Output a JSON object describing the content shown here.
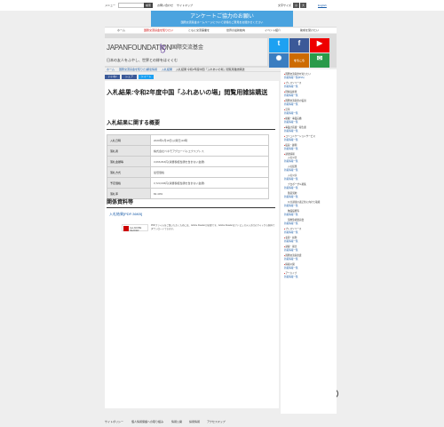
{
  "utility": {
    "menu": "メニュー",
    "search_btn": "検索",
    "link1": "お問い合わせ",
    "link2": "サイトマップ",
    "font_size": "文字サイズ",
    "fs_small": "小",
    "fs_large": "大",
    "lang": "English"
  },
  "banner": {
    "line1": "アンケートご協力のお願い",
    "line2": "国際交流基金ホームページについて皆様のご意見をお聞かせください"
  },
  "nav": [
    "ホーム",
    "国際交流基金を知りたい",
    "ともに交流事業を",
    "世界の最新動向",
    "イベント紹介",
    "助成を受けたい"
  ],
  "header": {
    "logo_en": "JAPANFOUNDATION",
    "logo_mark": "ɮ",
    "logo_jp": "国際交流基金",
    "tagline": "日本の友人をふやし、世界との絆をはぐくむ",
    "footer_text": "人物検索でPR"
  },
  "sns": [
    {
      "icon": "twitter-icon",
      "glyph": "t",
      "color": "#1da1f2"
    },
    {
      "icon": "facebook-icon",
      "glyph": "f",
      "color": "#3b5998"
    },
    {
      "icon": "youtube-icon",
      "glyph": "▶",
      "color": "#e00"
    },
    {
      "icon": "globe-icon",
      "glyph": "✺",
      "color": "#3b7dc0"
    },
    {
      "icon": "magazine-icon",
      "glyph": "をちこち",
      "color": "#cc6a00"
    },
    {
      "icon": "mail-icon",
      "glyph": "✉",
      "color": "#2a9a4a"
    }
  ],
  "breadcrumb": [
    "ホーム",
    "国際交流基金を知りたい",
    "調達情報",
    "入札結果",
    "入札結果:令和2年度中国「ふれあいの場」閲覧用雑誌購送"
  ],
  "share": [
    "いいね!",
    "シェア",
    "ツイート"
  ],
  "page": {
    "title": "入札結果:令和2年度中国「ふれあいの場」閲覧用雑誌購送",
    "section1": "入札結果に関する概要",
    "section2": "関係資料等",
    "download": "入札結果[PDF:36KB]",
    "acrobat": "Get ADOBE READER",
    "adobe_note": "PDFファイルをご覧いただくためには、Adobe Readerが必要です。Adobe Readerはアドビシステムズ社のサイトから無料でダウンロードできます。"
  },
  "info_table": [
    {
      "k": "入札日時",
      "v": "2020年2月18日(火曜日)10時"
    },
    {
      "k": "落札者",
      "v": "株式会社ベネモアグローバルエクスプレス"
    },
    {
      "k": "落札金額等",
      "v": "3,066,816円(消費税相当額を含まない金額)"
    },
    {
      "k": "落札方式",
      "v": "最低価格"
    },
    {
      "k": "予定価格",
      "v": "3,723,036円(消費税相当額を含まない金額)"
    },
    {
      "k": "落札率",
      "v": "82.40%"
    }
  ],
  "sidebar": [
    {
      "t": "国際交流基金を知りたい",
      "c": "head"
    },
    {
      "t": "新着情報一覧(RSS)",
      "c": "rss"
    },
    {
      "t": "プレスリリース",
      "c": "head"
    },
    {
      "t": "新着情報一覧",
      "c": "rss"
    },
    {
      "t": "理事長挨拶",
      "c": "head"
    },
    {
      "t": "新着情報一覧",
      "c": "rss"
    },
    {
      "t": "国際交流基金の役割",
      "c": "head"
    },
    {
      "t": "新着情報一覧",
      "c": "rss"
    },
    {
      "t": "沿革",
      "c": "head"
    },
    {
      "t": "新着情報一覧",
      "c": "rss"
    },
    {
      "t": "組織・事業実績",
      "c": "head"
    },
    {
      "t": "新着情報一覧",
      "c": "rss"
    },
    {
      "t": "事業計画書・報告書",
      "c": "head"
    },
    {
      "t": "新着情報一覧",
      "c": "rss"
    },
    {
      "t": "コミュニケーションサービス",
      "c": "head"
    },
    {
      "t": "新着情報一覧",
      "c": "rss"
    },
    {
      "t": "役員・顧問",
      "c": "head"
    },
    {
      "t": "新着情報一覧",
      "c": "rss"
    },
    {
      "t": "調達情報",
      "c": "head"
    },
    {
      "t": "入札公告",
      "c": "sub"
    },
    {
      "t": "新着情報一覧",
      "c": "rss"
    },
    {
      "t": "入札結果",
      "c": "sub"
    },
    {
      "t": "新着情報一覧",
      "c": "rss"
    },
    {
      "t": "入札公示",
      "c": "sub"
    },
    {
      "t": "新着情報一覧",
      "c": "rss"
    },
    {
      "t": "プロポーザル募集",
      "c": "sub"
    },
    {
      "t": "新着情報一覧",
      "c": "rss"
    },
    {
      "t": "随意契約",
      "c": "sub"
    },
    {
      "t": "新着情報一覧",
      "c": "rss"
    },
    {
      "t": "公共調達の適正化に向けた取組",
      "c": "sub"
    },
    {
      "t": "新着情報一覧",
      "c": "rss"
    },
    {
      "t": "物品役務等",
      "c": "sub"
    },
    {
      "t": "新着情報一覧",
      "c": "rss"
    },
    {
      "t": "契約監視委員会",
      "c": "sub"
    },
    {
      "t": "新着情報一覧",
      "c": "rss"
    },
    {
      "t": "プレスリリース",
      "c": "head"
    },
    {
      "t": "新着情報一覧",
      "c": "rss"
    },
    {
      "t": "表彰・叙勲",
      "c": "head"
    },
    {
      "t": "新着情報一覧",
      "c": "rss"
    },
    {
      "t": "調査・報告",
      "c": "head"
    },
    {
      "t": "新着情報一覧",
      "c": "rss"
    },
    {
      "t": "国際交流基金賞",
      "c": "head"
    },
    {
      "t": "新着情報一覧",
      "c": "rss"
    },
    {
      "t": "情報公開",
      "c": "head"
    },
    {
      "t": "新着情報一覧",
      "c": "rss"
    },
    {
      "t": "アーカイブ",
      "c": "head"
    },
    {
      "t": "新着情報一覧",
      "c": "rss"
    }
  ],
  "footer": [
    "サイトポリシー",
    "個人情報保護への取り組み",
    "情報公開",
    "採用情報",
    "アクセスマップ"
  ],
  "scroll_top": "︿"
}
